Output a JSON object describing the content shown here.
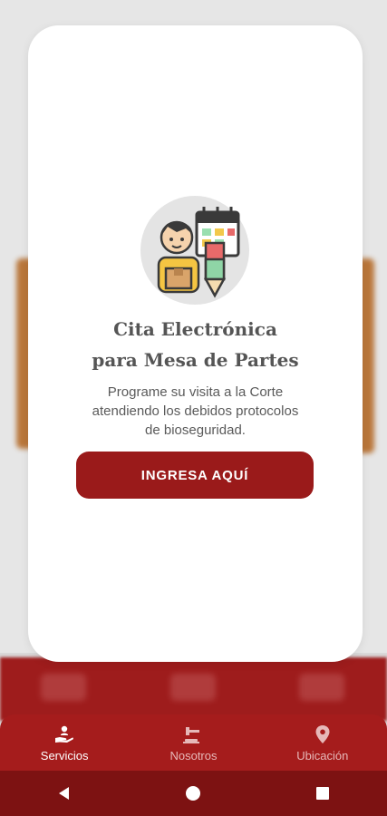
{
  "modal": {
    "title_line1": "Cita Electrónica",
    "title_line2": "para Mesa de Partes",
    "subtitle_line1": "Programe su visita a la Corte",
    "subtitle_line2": "atendiendo los debidos protocolos",
    "subtitle_line3": "de bioseguridad.",
    "cta_label": "INGRESA AQUÍ",
    "illustration_icon": "person-with-box-calendar-pencil"
  },
  "bottom_nav": {
    "items": [
      {
        "label": "Servicios",
        "icon": "hand-person-icon",
        "active": true
      },
      {
        "label": "Nosotros",
        "icon": "gavel-icon",
        "active": false
      },
      {
        "label": "Ubicación",
        "icon": "location-pin-icon",
        "active": false
      }
    ]
  },
  "system_nav": {
    "buttons": [
      "back-icon",
      "home-icon",
      "recents-icon"
    ]
  },
  "colors": {
    "brand": "#9a1a1a",
    "nav_bg": "#a51c1c",
    "system_bar": "#7d1212",
    "title_text": "#555555"
  }
}
